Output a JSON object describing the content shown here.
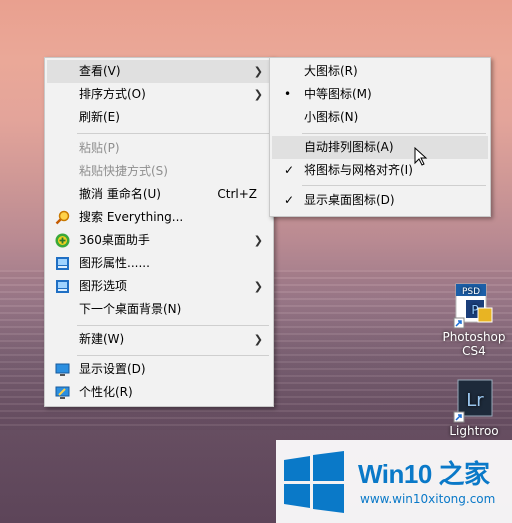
{
  "context_menu": {
    "items": [
      {
        "label": "查看(V)",
        "has_submenu": true
      },
      {
        "label": "排序方式(O)",
        "has_submenu": true
      },
      {
        "label": "刷新(E)"
      },
      {
        "label": "粘贴(P)",
        "disabled": true
      },
      {
        "label": "粘贴快捷方式(S)",
        "disabled": true
      },
      {
        "label": "撤消 重命名(U)",
        "shortcut": "Ctrl+Z"
      },
      {
        "label": "搜索 Everything...",
        "icon": "magnifier-icon"
      },
      {
        "label": "360桌面助手",
        "icon": "360-icon",
        "has_submenu": true
      },
      {
        "label": "图形属性......",
        "icon": "graphics-icon"
      },
      {
        "label": "图形选项",
        "icon": "graphics-icon",
        "has_submenu": true
      },
      {
        "label": "下一个桌面背景(N)"
      },
      {
        "label": "新建(W)",
        "has_submenu": true
      },
      {
        "label": "显示设置(D)",
        "icon": "display-icon"
      },
      {
        "label": "个性化(R)",
        "icon": "personalize-icon"
      }
    ]
  },
  "view_submenu": {
    "items": [
      {
        "label": "大图标(R)"
      },
      {
        "label": "中等图标(M)",
        "mark": "•"
      },
      {
        "label": "小图标(N)"
      },
      {
        "label": "自动排列图标(A)",
        "highlighted": true
      },
      {
        "label": "将图标与网格对齐(I)",
        "mark": "✓"
      },
      {
        "label": "显示桌面图标(D)",
        "mark": "✓"
      }
    ]
  },
  "desktop_icons": [
    {
      "label_line1": "Photoshop",
      "label_line2": "CS4",
      "icon_text": "PSD"
    },
    {
      "label_line1": "Lightroo",
      "icon_text": "Lr"
    }
  ],
  "watermark": {
    "brand": "Win10 之家",
    "site": "www.win10xitong.com"
  },
  "colors": {
    "accent": "#0a79c8",
    "menu_bg": "#f2f2f2",
    "highlight": "#e0e0e0"
  }
}
